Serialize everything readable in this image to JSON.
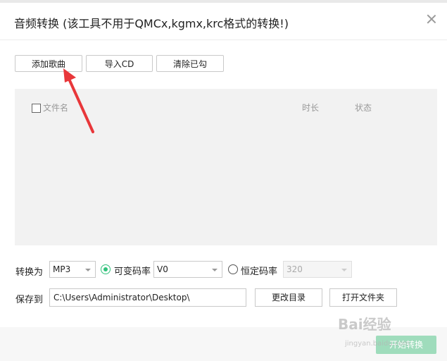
{
  "dialog": {
    "title": "音频转换 (该工具不用于QMCx,kgmx,krc格式的转换!)",
    "close_icon": "close-icon"
  },
  "toolbar": {
    "add_song": "添加歌曲",
    "import_cd": "导入CD",
    "clear_checked": "清除已勾"
  },
  "file_list": {
    "columns": {
      "filename": "文件名",
      "duration": "时长",
      "status": "状态"
    },
    "select_all_checked": false,
    "rows": []
  },
  "convert": {
    "label": "转换为",
    "format": "MP3",
    "vbr_label": "可变码率",
    "vbr_selected": true,
    "vbr_value": "V0",
    "cbr_label": "恒定码率",
    "cbr_selected": false,
    "cbr_value": "320"
  },
  "save": {
    "label": "保存到",
    "path": "C:\\Users\\Administrator\\Desktop\\",
    "change_dir": "更改目录",
    "open_folder": "打开文件夹"
  },
  "footer": {
    "start_button": "开始转换"
  },
  "watermark": {
    "text": "Bai经验",
    "sub": "jingyan.baidu.com"
  },
  "colors": {
    "accent": "#31c27c",
    "annotation_arrow": "#e8373a"
  }
}
